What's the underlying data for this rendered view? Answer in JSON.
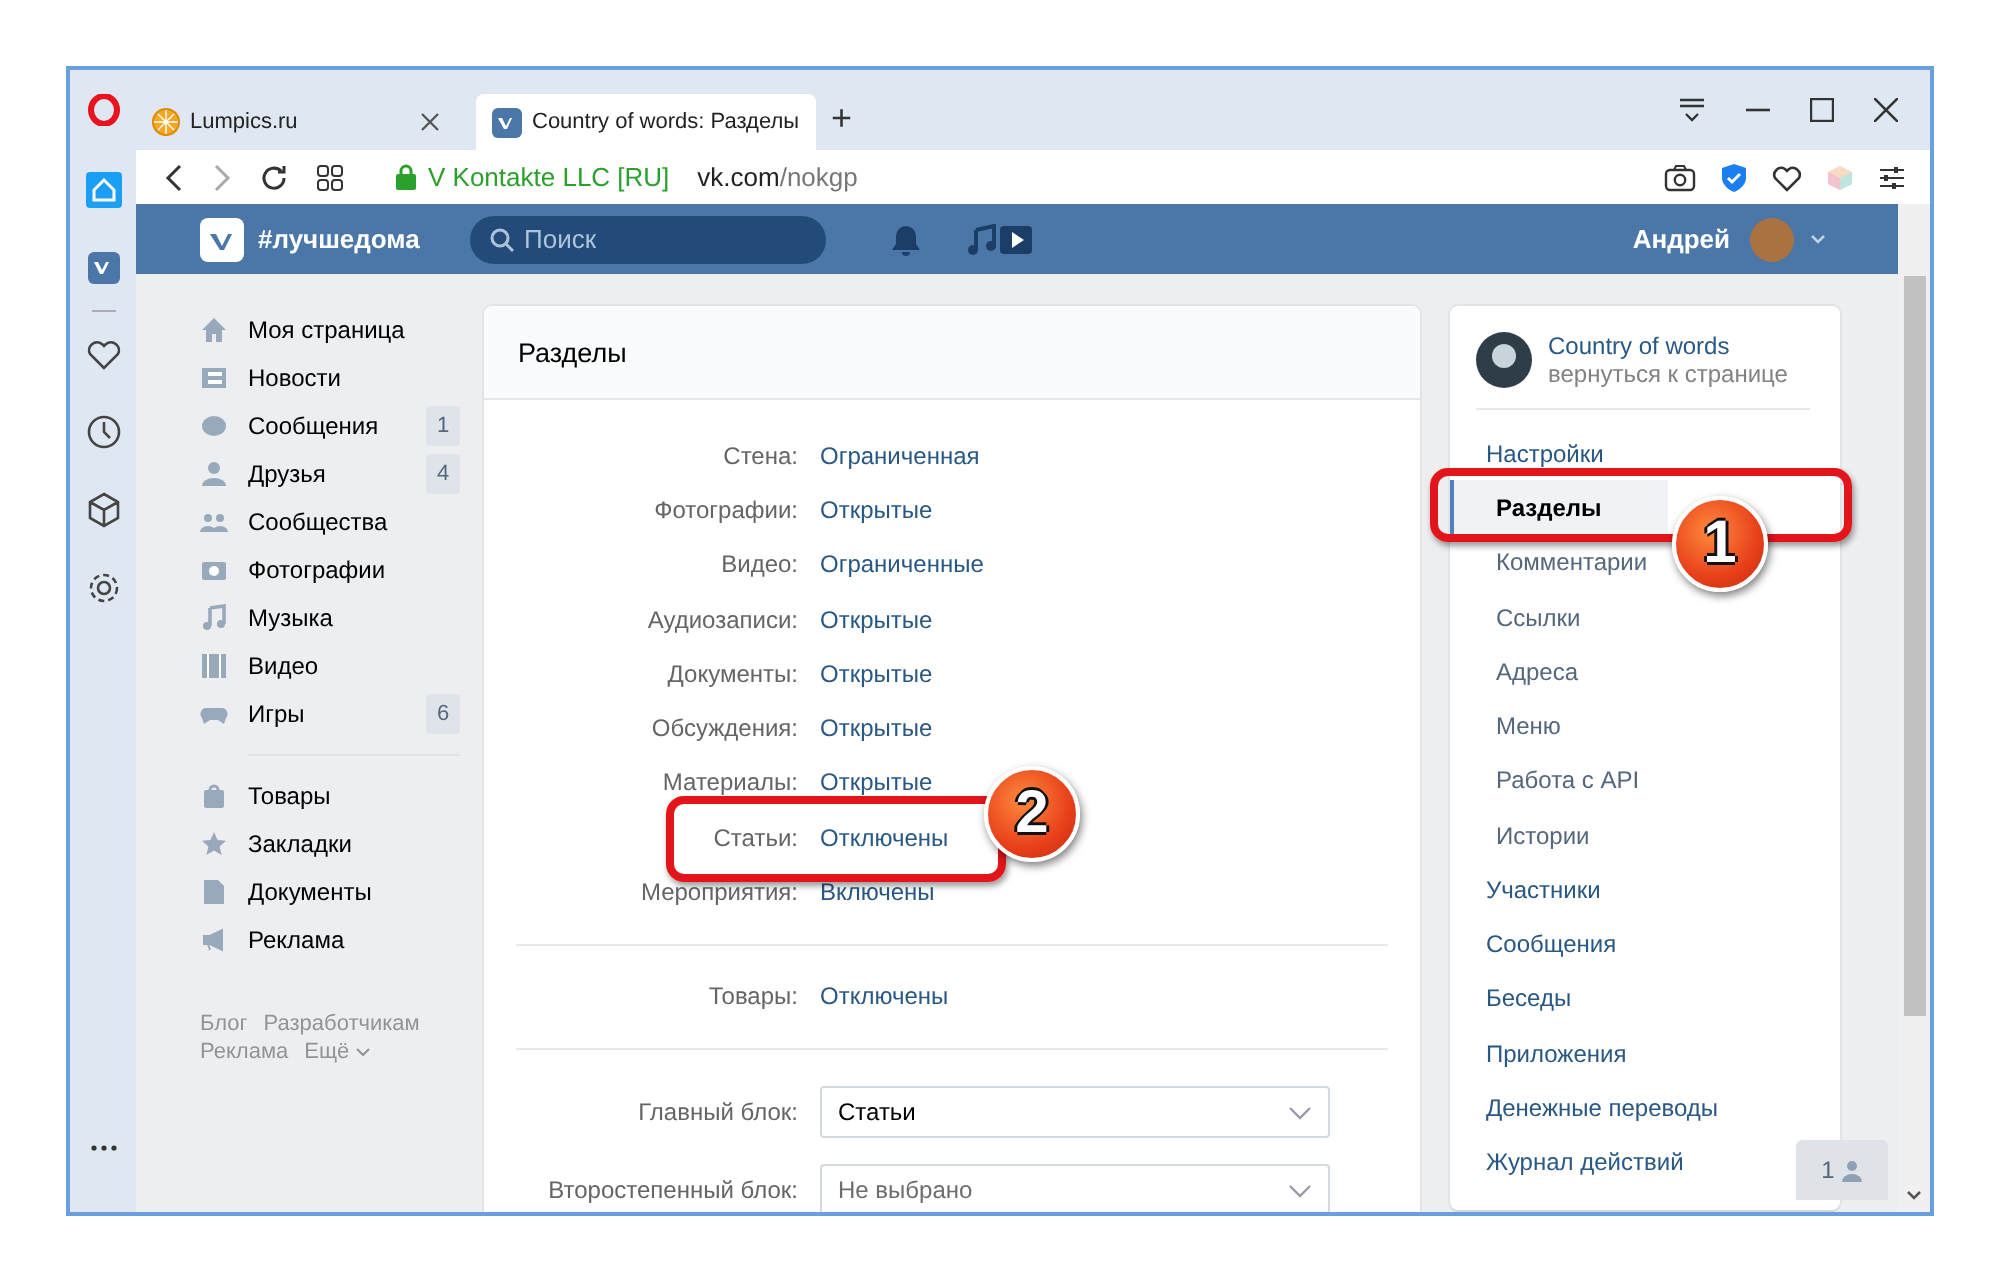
{
  "browser": {
    "tabs": [
      {
        "title": "Lumpics.ru",
        "selected": false
      },
      {
        "title": "Country of words: Разделы",
        "selected": true
      }
    ],
    "new_tab": "+",
    "site_identity": "V Kontakte LLC [RU]",
    "url_host": "vk.com",
    "url_path": "/nokgp"
  },
  "header": {
    "brand": "#лучшедома",
    "search_placeholder": "Поиск",
    "user_name": "Андрей"
  },
  "left_nav": {
    "groups": [
      [
        {
          "label": "Моя страница"
        },
        {
          "label": "Новости"
        },
        {
          "label": "Сообщения",
          "badge": "1"
        },
        {
          "label": "Друзья",
          "badge": "4"
        },
        {
          "label": "Сообщества"
        },
        {
          "label": "Фотографии"
        },
        {
          "label": "Музыка"
        },
        {
          "label": "Видео"
        },
        {
          "label": "Игры",
          "badge": "6"
        }
      ],
      [
        {
          "label": "Товары"
        },
        {
          "label": "Закладки"
        },
        {
          "label": "Документы"
        },
        {
          "label": "Реклама"
        }
      ]
    ],
    "footer_links": [
      "Блог",
      "Разработчикам",
      "Реклама",
      "Ещё"
    ]
  },
  "sections": {
    "title": "Разделы",
    "rows": [
      {
        "label": "Стена:",
        "value": "Ограниченная"
      },
      {
        "label": "Фотографии:",
        "value": "Открытые"
      },
      {
        "label": "Видео:",
        "value": "Ограниченные"
      },
      {
        "label": "Аудиозаписи:",
        "value": "Открытые"
      },
      {
        "label": "Документы:",
        "value": "Открытые"
      },
      {
        "label": "Обсуждения:",
        "value": "Открытые"
      },
      {
        "label": "Материалы:",
        "value": "Открытые"
      },
      {
        "label": "Статьи:",
        "value": "Отключены"
      },
      {
        "label": "Мероприятия:",
        "value": "Включены"
      }
    ],
    "goods": {
      "label": "Товары:",
      "value": "Отключены"
    },
    "selects": [
      {
        "label": "Главный блок:",
        "value": "Статьи"
      },
      {
        "label": "Второстепенный блок:",
        "placeholder": "Не выбрано"
      }
    ]
  },
  "right_menu": {
    "community": {
      "name": "Country of words",
      "back_link": "вернуться к странице"
    },
    "items": [
      {
        "label": "Настройки",
        "selected": false,
        "children": [
          {
            "label": "Разделы",
            "selected": true
          },
          {
            "label": "Комментарии",
            "selected": false
          },
          {
            "label": "Ссылки",
            "selected": false
          },
          {
            "label": "Адреса",
            "selected": false
          },
          {
            "label": "Меню",
            "selected": false
          },
          {
            "label": "Работа с API",
            "selected": false
          },
          {
            "label": "Истории",
            "selected": false
          }
        ]
      },
      {
        "label": "Участники",
        "selected": false
      },
      {
        "label": "Сообщения",
        "selected": false
      },
      {
        "label": "Беседы",
        "selected": false
      },
      {
        "label": "Приложения",
        "selected": false
      },
      {
        "label": "Денежные переводы",
        "selected": false
      },
      {
        "label": "Журнал действий",
        "selected": false
      }
    ]
  },
  "online_friends": {
    "count": "1"
  },
  "annotations": [
    {
      "number": "1"
    },
    {
      "number": "2"
    }
  ]
}
